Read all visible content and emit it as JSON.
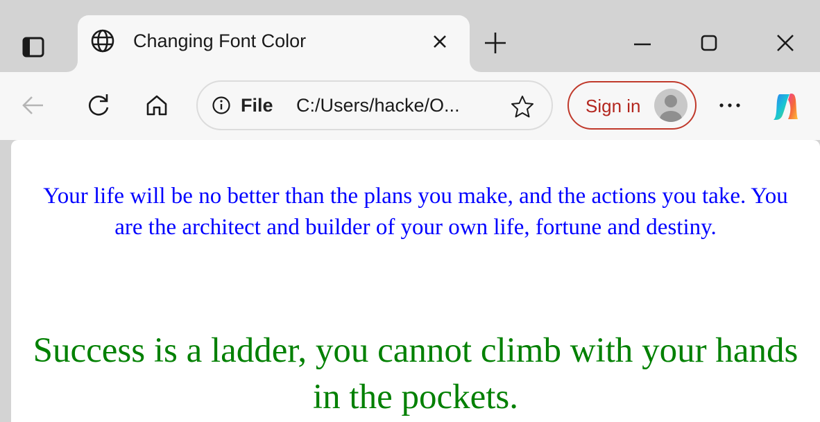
{
  "tab": {
    "title": "Changing Font Color",
    "favicon": "globe-icon"
  },
  "toolbar": {
    "site_label": "File",
    "url": "C:/Users/hacke/O...",
    "signin_label": "Sign in",
    "more_label": "···"
  },
  "content": {
    "quote_1": "Your life will be no better than the plans you make, and the actions you take. You are the architect and builder of your own life, fortune and destiny.",
    "quote_1_color": "#0000ff",
    "quote_2": "Success is a ladder, you cannot climb with your hands in the pockets.",
    "quote_2_color": "#008000"
  },
  "icons": {
    "tab_actions": "tab-actions-icon",
    "close_tab": "close-icon",
    "new_tab": "plus-icon",
    "minimize": "minimize-icon",
    "maximize": "maximize-icon",
    "close_window": "close-icon",
    "back": "back-arrow-icon",
    "refresh": "refresh-icon",
    "home": "home-icon",
    "info": "info-icon",
    "favorite": "star-icon",
    "profile": "avatar",
    "copilot": "copilot-icon"
  }
}
